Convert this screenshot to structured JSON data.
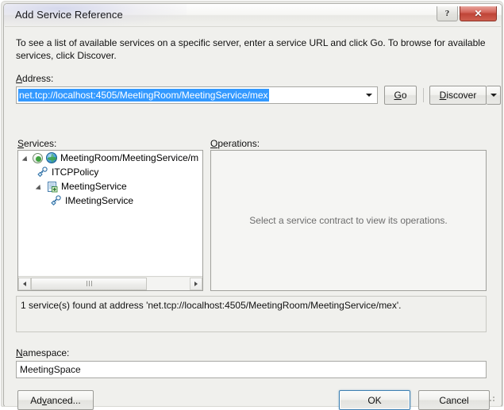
{
  "window": {
    "title": "Add Service Reference",
    "help_button": "?",
    "close_button": "✕"
  },
  "intro": {
    "text": "To see a list of available services on a specific server, enter a service URL and click Go. To browse for available services, click Discover."
  },
  "address": {
    "label": "Address:",
    "value": "net.tcp://localhost:4505/MeetingRoom/MeetingService/mex",
    "placeholder": "",
    "selected": true,
    "selection_color": "#3399ff",
    "go_label": "Go",
    "discover_label": "Discover",
    "discover_split_arrow": "▾"
  },
  "services": {
    "label": "Services:",
    "tree": [
      {
        "label": "MeetingRoom/MeetingService/m",
        "level": 0,
        "expanded": true,
        "icons": [
          "endpoint-icon",
          "globe-icon"
        ],
        "truncated": true
      },
      {
        "label": "ITCPPolicy",
        "level": 1,
        "expanded": false,
        "icons": [
          "interface-icon"
        ]
      },
      {
        "label": "MeetingService",
        "level": 1,
        "expanded": true,
        "icons": [
          "service-icon"
        ]
      },
      {
        "label": "IMeetingService",
        "level": 2,
        "expanded": false,
        "icons": [
          "interface-icon"
        ]
      }
    ],
    "scrollbar": {
      "left_arrow": "◂",
      "right_arrow": "▸",
      "thumb_grip": "|||"
    }
  },
  "operations": {
    "label": "Operations:",
    "placeholder": "Select a service contract to view its operations."
  },
  "status": {
    "message": "1 service(s) found at address 'net.tcp://localhost:4505/MeetingRoom/MeetingService/mex'."
  },
  "namespace": {
    "label": "Namespace:",
    "value": "MeetingSpace",
    "placeholder": ""
  },
  "buttons": {
    "advanced": "Advanced...",
    "ok": "OK",
    "cancel": "Cancel"
  },
  "colors": {
    "selection_blue": "#3399ff",
    "default_button_border": "#3c7fb1",
    "close_red": "#bf4437",
    "dialog_background": "#f0f0ed"
  }
}
